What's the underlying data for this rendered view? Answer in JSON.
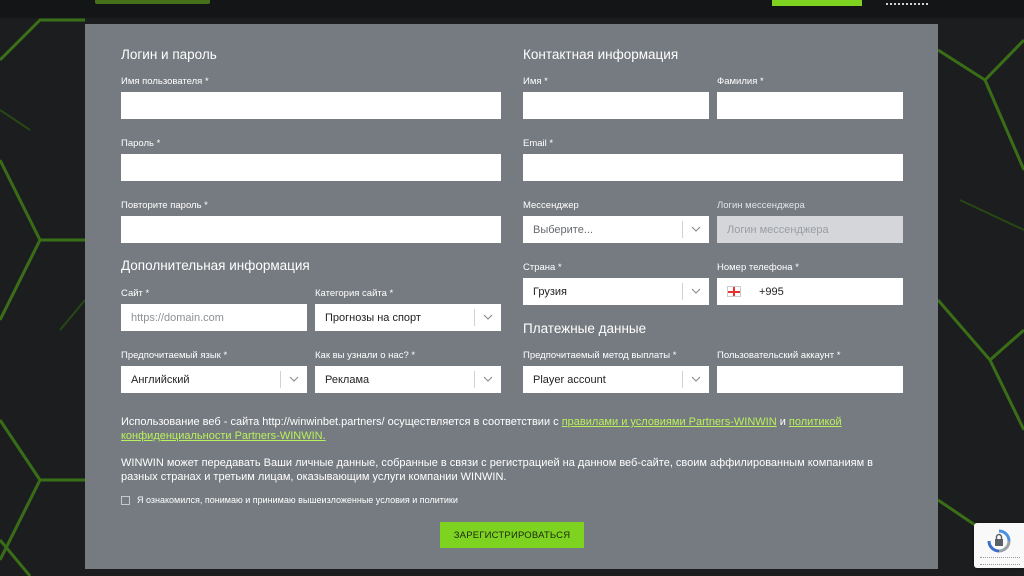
{
  "login_section": {
    "title": "Логин и пароль",
    "username_label": "Имя пользователя *",
    "password_label": "Пароль *",
    "repeat_password_label": "Повторите пароль *"
  },
  "contact_section": {
    "title": "Контактная информация",
    "first_name_label": "Имя *",
    "last_name_label": "Фамилия *",
    "email_label": "Email *",
    "messenger_label": "Мессенджер",
    "messenger_value": "Выберите...",
    "messenger_login_label": "Логин мессенджера",
    "messenger_login_placeholder": "Логин мессенджера",
    "country_label": "Страна *",
    "country_value": "Грузия",
    "phone_label": "Номер телефона *",
    "phone_code": "+995"
  },
  "additional_section": {
    "title": "Дополнительная информация",
    "site_label": "Сайт *",
    "site_placeholder": "https://domain.com",
    "category_label": "Категория сайта *",
    "category_value": "Прогнозы на спорт",
    "language_label": "Предпочитаемый язык *",
    "language_value": "Английский",
    "source_label": "Как вы узнали о нас? *",
    "source_value": "Реклама"
  },
  "payment_section": {
    "title": "Платежные данные",
    "method_label": "Предпочитаемый метод выплаты *",
    "method_value": "Player account",
    "account_label": "Пользовательский аккаунт *"
  },
  "terms": {
    "line1_prefix": "Использование веб - сайта http://winwinbet.partners/ осуществляется в соответствии с ",
    "rules_link": "правилами и условиями Partners-WINWIN",
    "and": " и ",
    "privacy_link": "политикой конфиденциальности Partners-WINWIN.",
    "line2": "WINWIN может передавать Ваши личные данные, собранные в связи с регистрацией на данном веб-сайте, своим аффилированным компаниям в разных странах и третьим лицам, оказывающим услуги компании WINWIN.",
    "checkbox_label": "Я ознакомился, понимаю и принимаю вышеизложенные условия и политики"
  },
  "submit_label": "ЗАРЕГИСТРИРОВАТЬСЯ",
  "colors": {
    "accent": "#7ed321",
    "panel": "#767b81",
    "background": "#1c1d1f",
    "link": "#b9f25a"
  },
  "icons": {
    "select_arrow": "chevron-down-icon",
    "flag": "georgia-flag-icon",
    "captcha": "recaptcha-icon"
  }
}
